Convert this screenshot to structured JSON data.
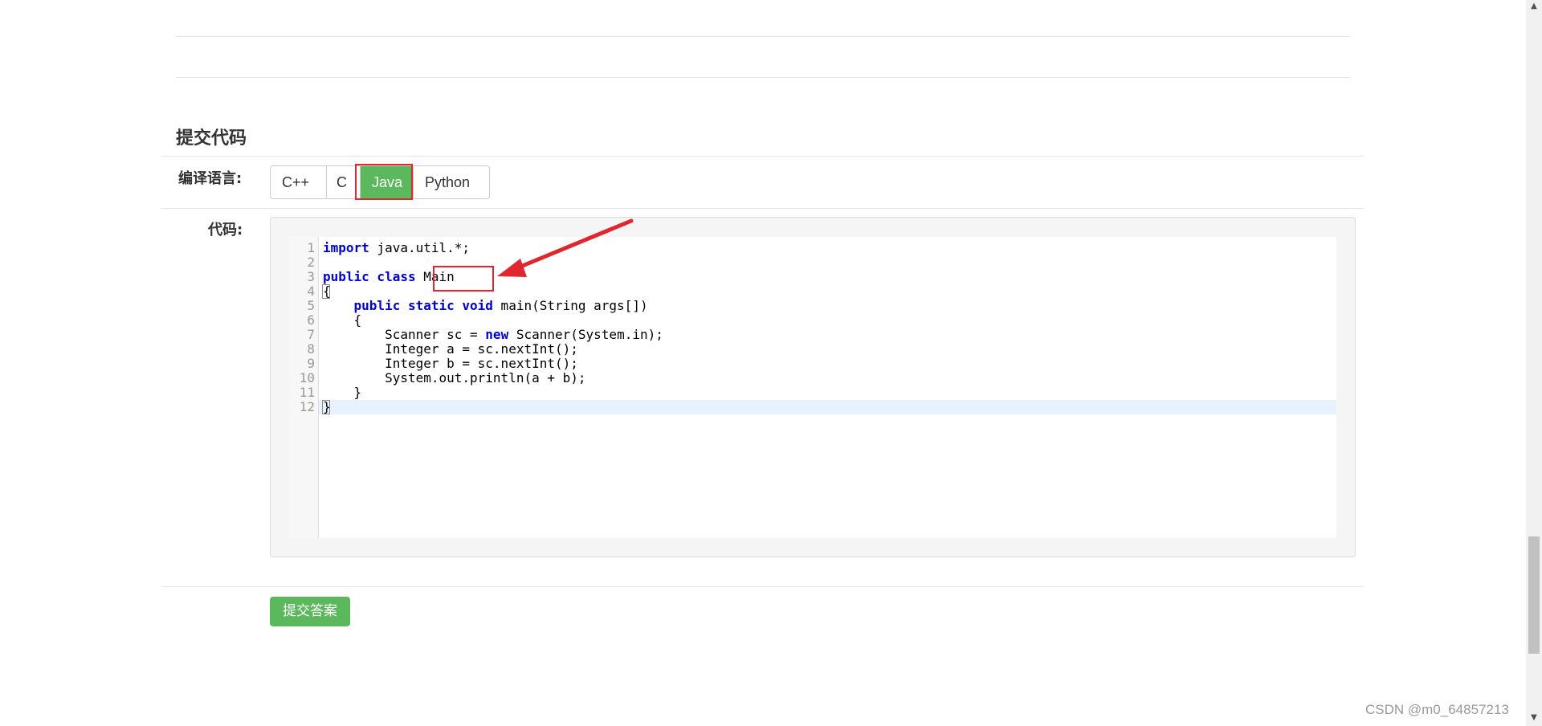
{
  "section": {
    "title": "提交代码"
  },
  "language": {
    "label": "编译语言:",
    "options": [
      "C++",
      "C",
      "Java",
      "Python"
    ],
    "selected": "Java"
  },
  "code": {
    "label": "代码:",
    "line_numbers": [
      "1",
      "2",
      "3",
      "4",
      "5",
      "6",
      "7",
      "8",
      "9",
      "10",
      "11",
      "12"
    ],
    "lines": [
      {
        "kw": "import",
        "rest": " java.util.*;"
      },
      {
        "kw": "",
        "rest": ""
      },
      {
        "kw": "public class",
        "rest": " Main"
      },
      {
        "kw": "",
        "rest": "{"
      },
      {
        "pre": "    ",
        "kw": "public static void",
        "rest": " main(String args[])"
      },
      {
        "kw": "",
        "rest": "    {"
      },
      {
        "pre": "        Scanner sc = ",
        "kw": "new",
        "rest": " Scanner(System.in);"
      },
      {
        "kw": "",
        "rest": "        Integer a = sc.nextInt();"
      },
      {
        "kw": "",
        "rest": "        Integer b = sc.nextInt();"
      },
      {
        "kw": "",
        "rest": "        System.out.println(a + b);"
      },
      {
        "kw": "",
        "rest": "    }"
      },
      {
        "kw": "",
        "rest": "}"
      }
    ]
  },
  "submit": {
    "label": "提交答案"
  },
  "watermark": "CSDN @m0_64857213",
  "colors": {
    "accent": "#5cb85c",
    "annotation": "#e0262f",
    "keyword": "#0000cc"
  },
  "icons": {
    "scroll_up": "scroll-up-arrow-icon",
    "scroll_down": "scroll-down-arrow-icon",
    "annotation": "red-arrow-icon"
  }
}
